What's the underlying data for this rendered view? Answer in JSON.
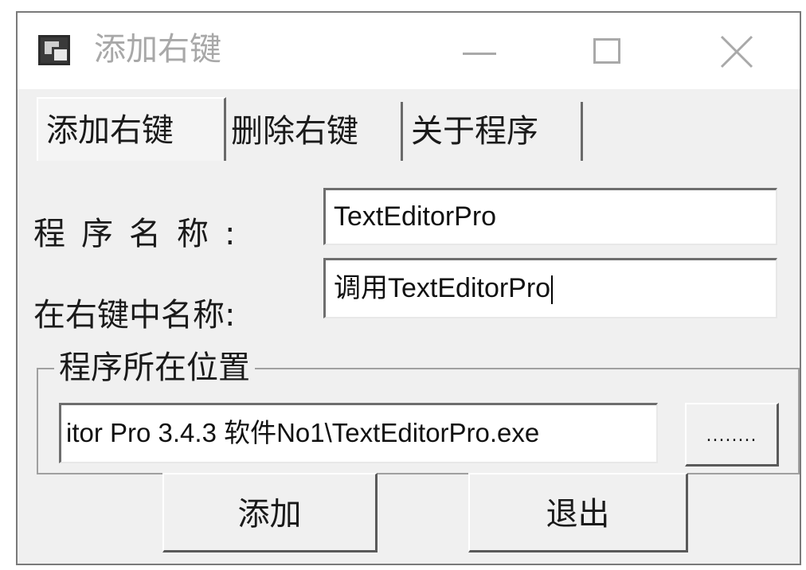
{
  "window": {
    "title": "添加右键",
    "controls": {
      "minimize_icon": "minimize-icon",
      "maximize_icon": "maximize-icon",
      "close_icon": "close-icon"
    }
  },
  "tabs": [
    {
      "label": "添加右键",
      "selected": true
    },
    {
      "label": "删除右键",
      "selected": false
    },
    {
      "label": "关于程序",
      "selected": false
    }
  ],
  "form": {
    "program_name_label": "程序名称:",
    "program_name_value": "TextEditorPro",
    "menu_name_label": "在右键中名称:",
    "menu_name_value": "调用TextEditorPro",
    "location_group_label": "程序所在位置",
    "location_value": "itor Pro 3.4.3 软件No1\\TextEditorPro.exe",
    "browse_label": "........"
  },
  "buttons": {
    "add_label": "添加",
    "exit_label": "退出"
  }
}
